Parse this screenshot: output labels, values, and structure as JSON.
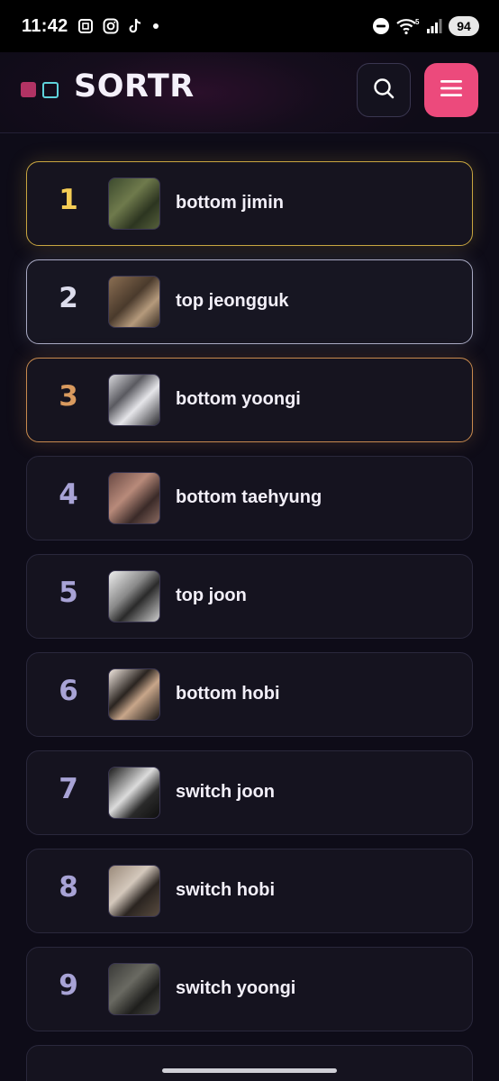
{
  "status_bar": {
    "time": "11:42",
    "battery": "94",
    "network_badge": "5",
    "icons": [
      "screenshot-icon",
      "instagram-icon",
      "tiktok-icon",
      "notification-dot-icon",
      "dnd-icon",
      "wifi-icon",
      "signal-icon"
    ]
  },
  "header": {
    "brand": "SORTR",
    "logo_colors": {
      "filled": "#b23364",
      "outline": "#5fd3dc"
    },
    "search_icon": "search-icon",
    "menu_icon": "hamburger-menu-icon",
    "menu_color": "#ec4a7c"
  },
  "ranking": {
    "items": [
      {
        "rank": "1",
        "name": "bottom jimin",
        "accent": "#f5cd55"
      },
      {
        "rank": "2",
        "name": "top jeongguk",
        "accent": "#dcdcec"
      },
      {
        "rank": "3",
        "name": "bottom yoongi",
        "accent": "#d99a5e"
      },
      {
        "rank": "4",
        "name": "bottom taehyung"
      },
      {
        "rank": "5",
        "name": "top joon"
      },
      {
        "rank": "6",
        "name": "bottom hobi"
      },
      {
        "rank": "7",
        "name": "switch joon"
      },
      {
        "rank": "8",
        "name": "switch hobi"
      },
      {
        "rank": "9",
        "name": "switch yoongi"
      }
    ]
  }
}
